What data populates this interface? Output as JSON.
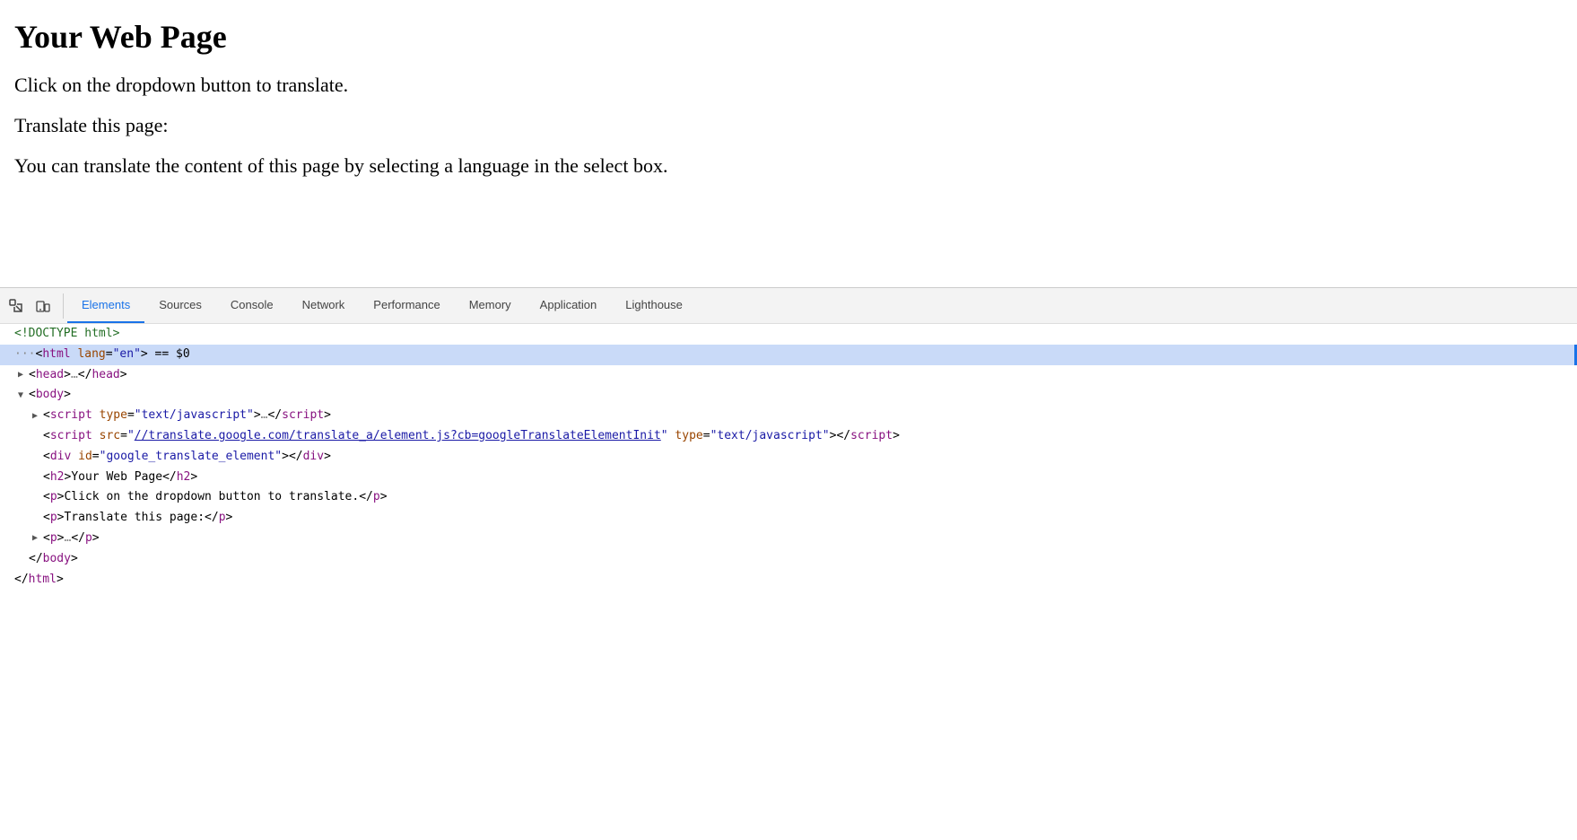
{
  "page": {
    "title": "Your Web Page",
    "paragraphs": [
      "Click on the dropdown button to translate.",
      "Translate this page:",
      "You can translate the content of this page by selecting a language in the select box."
    ]
  },
  "devtools": {
    "tabs": [
      {
        "id": "elements",
        "label": "Elements",
        "active": true
      },
      {
        "id": "sources",
        "label": "Sources",
        "active": false
      },
      {
        "id": "console",
        "label": "Console",
        "active": false
      },
      {
        "id": "network",
        "label": "Network",
        "active": false
      },
      {
        "id": "performance",
        "label": "Performance",
        "active": false
      },
      {
        "id": "memory",
        "label": "Memory",
        "active": false
      },
      {
        "id": "application",
        "label": "Application",
        "active": false
      },
      {
        "id": "lighthouse",
        "label": "Lighthouse",
        "active": false
      }
    ],
    "elements": {
      "lines": [
        {
          "id": "doctype",
          "indent": 0,
          "arrow": "empty",
          "content_type": "doctype",
          "text": "<!DOCTYPE html>"
        },
        {
          "id": "html-open",
          "indent": 0,
          "arrow": "empty",
          "content_type": "html-tag-highlighted",
          "text": ""
        },
        {
          "id": "head",
          "indent": 1,
          "arrow": "right",
          "content_type": "collapsed-tag",
          "tag": "head",
          "inner": "…"
        },
        {
          "id": "body-open",
          "indent": 1,
          "arrow": "down",
          "content_type": "open-tag",
          "tag": "body"
        },
        {
          "id": "script1",
          "indent": 2,
          "arrow": "right",
          "content_type": "script-collapsed",
          "text": ""
        },
        {
          "id": "script2",
          "indent": 2,
          "arrow": "empty",
          "content_type": "script-src",
          "text": ""
        },
        {
          "id": "div-google",
          "indent": 2,
          "arrow": "empty",
          "content_type": "div-google",
          "text": ""
        },
        {
          "id": "h2",
          "indent": 2,
          "arrow": "empty",
          "content_type": "h2",
          "text": ""
        },
        {
          "id": "p1",
          "indent": 2,
          "arrow": "empty",
          "content_type": "p1",
          "text": ""
        },
        {
          "id": "p2",
          "indent": 2,
          "arrow": "empty",
          "content_type": "p2",
          "text": ""
        },
        {
          "id": "p3",
          "indent": 2,
          "arrow": "right",
          "content_type": "p-collapsed",
          "text": ""
        },
        {
          "id": "body-close",
          "indent": 1,
          "arrow": "empty",
          "content_type": "close-body",
          "text": ""
        },
        {
          "id": "html-close",
          "indent": 0,
          "arrow": "empty",
          "content_type": "close-html",
          "text": ""
        }
      ]
    }
  }
}
